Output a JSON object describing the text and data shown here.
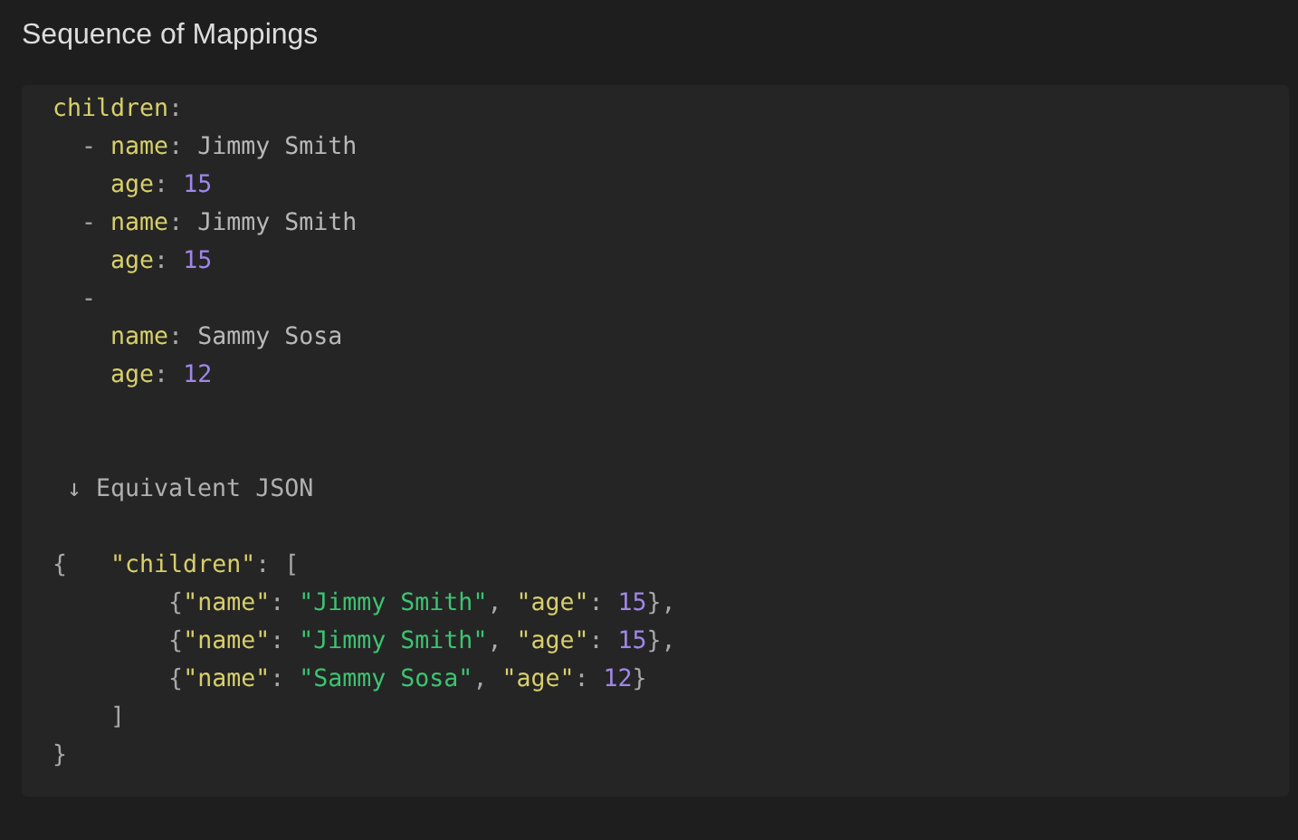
{
  "title": "Sequence of Mappings",
  "yaml_lines": [
    [
      {
        "text": "children",
        "kind": "key"
      },
      {
        "text": ":",
        "kind": "punct"
      }
    ],
    [
      {
        "text": "  - ",
        "kind": "punct"
      },
      {
        "text": "name",
        "kind": "key"
      },
      {
        "text": ": ",
        "kind": "punct"
      },
      {
        "text": "Jimmy Smith",
        "kind": "plain"
      }
    ],
    [
      {
        "text": "    age",
        "kind": "key"
      },
      {
        "text": ": ",
        "kind": "punct"
      },
      {
        "text": "15",
        "kind": "number"
      }
    ],
    [
      {
        "text": "  - ",
        "kind": "punct"
      },
      {
        "text": "name",
        "kind": "key"
      },
      {
        "text": ": ",
        "kind": "punct"
      },
      {
        "text": "Jimmy Smith",
        "kind": "plain"
      }
    ],
    [
      {
        "text": "    age",
        "kind": "key"
      },
      {
        "text": ": ",
        "kind": "punct"
      },
      {
        "text": "15",
        "kind": "number"
      }
    ],
    [
      {
        "text": "  -",
        "kind": "punct"
      }
    ],
    [
      {
        "text": "    name",
        "kind": "key"
      },
      {
        "text": ": ",
        "kind": "punct"
      },
      {
        "text": "Sammy Sosa",
        "kind": "plain"
      }
    ],
    [
      {
        "text": "    age",
        "kind": "key"
      },
      {
        "text": ": ",
        "kind": "punct"
      },
      {
        "text": "12",
        "kind": "number"
      }
    ]
  ],
  "caption": "↓ Equivalent JSON",
  "json_lines": [
    [
      {
        "text": "{   ",
        "kind": "punct"
      },
      {
        "text": "\"children\"",
        "kind": "key"
      },
      {
        "text": ": [",
        "kind": "punct"
      }
    ],
    [
      {
        "text": "        {",
        "kind": "punct"
      },
      {
        "text": "\"name\"",
        "kind": "key"
      },
      {
        "text": ": ",
        "kind": "punct"
      },
      {
        "text": "\"Jimmy Smith\"",
        "kind": "string"
      },
      {
        "text": ", ",
        "kind": "punct"
      },
      {
        "text": "\"age\"",
        "kind": "key"
      },
      {
        "text": ": ",
        "kind": "punct"
      },
      {
        "text": "15",
        "kind": "number"
      },
      {
        "text": "},",
        "kind": "punct"
      }
    ],
    [
      {
        "text": "        {",
        "kind": "punct"
      },
      {
        "text": "\"name\"",
        "kind": "key"
      },
      {
        "text": ": ",
        "kind": "punct"
      },
      {
        "text": "\"Jimmy Smith\"",
        "kind": "string"
      },
      {
        "text": ", ",
        "kind": "punct"
      },
      {
        "text": "\"age\"",
        "kind": "key"
      },
      {
        "text": ": ",
        "kind": "punct"
      },
      {
        "text": "15",
        "kind": "number"
      },
      {
        "text": "},",
        "kind": "punct"
      }
    ],
    [
      {
        "text": "        {",
        "kind": "punct"
      },
      {
        "text": "\"name\"",
        "kind": "key"
      },
      {
        "text": ": ",
        "kind": "punct"
      },
      {
        "text": "\"Sammy Sosa\"",
        "kind": "string"
      },
      {
        "text": ", ",
        "kind": "punct"
      },
      {
        "text": "\"age\"",
        "kind": "key"
      },
      {
        "text": ": ",
        "kind": "punct"
      },
      {
        "text": "12",
        "kind": "number"
      },
      {
        "text": "}",
        "kind": "punct"
      }
    ],
    [
      {
        "text": "    ]",
        "kind": "punct"
      }
    ],
    [
      {
        "text": "}",
        "kind": "punct"
      }
    ]
  ]
}
